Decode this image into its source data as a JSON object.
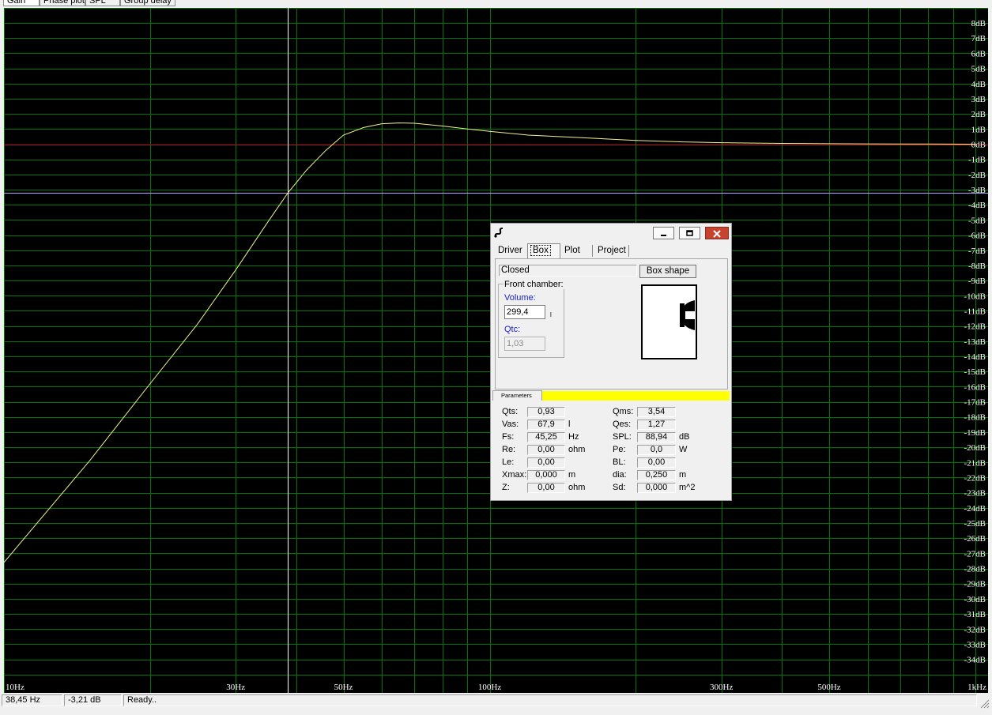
{
  "tabs": {
    "gain": "Gain",
    "phase": "Phase plot",
    "spl": "SPL",
    "group_delay": "Group delay"
  },
  "status": {
    "freq": "38,45 Hz",
    "level": "-3,21 dB",
    "message": "Ready.."
  },
  "chart_data": {
    "type": "line",
    "title": "",
    "xlabel": "",
    "ylabel": "",
    "x_scale": "log",
    "xlim": [
      10,
      1000
    ],
    "ylim": [
      -35,
      9
    ],
    "grid": true,
    "x_tick_labels": [
      {
        "v": 10,
        "t": "10Hz"
      },
      {
        "v": 30,
        "t": "30Hz"
      },
      {
        "v": 50,
        "t": "50Hz"
      },
      {
        "v": 100,
        "t": "100Hz"
      },
      {
        "v": 300,
        "t": "300Hz"
      },
      {
        "v": 500,
        "t": "500Hz"
      },
      {
        "v": 1000,
        "t": "1kHz"
      }
    ],
    "y_tick_labels": [
      8,
      7,
      6,
      5,
      4,
      3,
      2,
      1,
      0,
      -1,
      -2,
      -3,
      -4,
      -5,
      -6,
      -7,
      -8,
      -9,
      -10,
      -11,
      -12,
      -13,
      -14,
      -15,
      -16,
      -17,
      -18,
      -19,
      -20,
      -21,
      -22,
      -23,
      -24,
      -25,
      -26,
      -27,
      -28,
      -29,
      -30,
      -31,
      -32,
      -33,
      -34
    ],
    "y_unit": "dB",
    "reference_lines": {
      "zero_db": 0,
      "minus3_db": -3.2
    },
    "cursor_x": 38.45,
    "colors": {
      "background": "#000000",
      "grid": "#007800",
      "curve": "#f2f28a",
      "zero_line": "#c01818",
      "minus3_line": "#b0a8ff",
      "cursor": "#ffffff",
      "ticks": "#ffffff"
    },
    "series": [
      {
        "name": "",
        "x": [
          10,
          15,
          20,
          25,
          30,
          35,
          38.45,
          42,
          46,
          50,
          55,
          60,
          65,
          70,
          80,
          90,
          100,
          120,
          150,
          200,
          250,
          300,
          400,
          500,
          600,
          800,
          1000
        ],
        "y": [
          -27.6,
          -20.9,
          -15.8,
          -11.9,
          -8.3,
          -5.1,
          -3.2,
          -1.7,
          -0.4,
          0.6,
          1.1,
          1.35,
          1.4,
          1.38,
          1.2,
          1.0,
          0.85,
          0.6,
          0.45,
          0.25,
          0.15,
          0.1,
          0.05,
          0.03,
          0.02,
          0.01,
          0.0
        ]
      }
    ]
  },
  "dialog": {
    "tabs": {
      "driver": "Driver",
      "box": "Box",
      "plot": "Plot",
      "project": "Project"
    },
    "box_type": "Closed",
    "box_shape_button": "Box shape",
    "front_chamber_label": "Front chamber:",
    "volume_label": "Volume:",
    "volume_value": "299,4",
    "volume_unit": "l",
    "qtc_label": "Qtc:",
    "qtc_value": "1,03",
    "parameters_label": "Parameters",
    "params_left": [
      {
        "label": "Qts:",
        "value": "0,93",
        "unit": ""
      },
      {
        "label": "Vas:",
        "value": "67,9",
        "unit": "l"
      },
      {
        "label": "Fs:",
        "value": "45,25",
        "unit": "Hz"
      },
      {
        "label": "Re:",
        "value": "0,00",
        "unit": "ohm"
      },
      {
        "label": "Le:",
        "value": "0,00",
        "unit": ""
      },
      {
        "label": "Xmax:",
        "value": "0,000",
        "unit": "m"
      },
      {
        "label": "Z:",
        "value": "0,00",
        "unit": "ohm"
      }
    ],
    "params_right": [
      {
        "label": "Qms:",
        "value": "3,54",
        "unit": ""
      },
      {
        "label": "Qes:",
        "value": "1,27",
        "unit": ""
      },
      {
        "label": "SPL:",
        "value": "88,94",
        "unit": "dB"
      },
      {
        "label": "Pe:",
        "value": "0,0",
        "unit": "W"
      },
      {
        "label": "BL:",
        "value": "0,00",
        "unit": ""
      },
      {
        "label": "dia:",
        "value": "0,250",
        "unit": "m"
      },
      {
        "label": "Sd:",
        "value": "0,000",
        "unit": "m^2"
      }
    ]
  }
}
